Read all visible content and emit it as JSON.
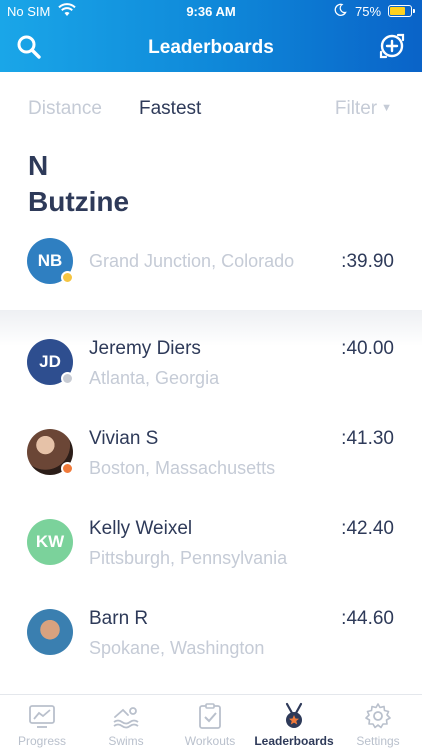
{
  "status_bar": {
    "carrier": "No SIM",
    "time": "9:36 AM",
    "battery": "75%"
  },
  "header": {
    "title": "Leaderboards",
    "search_icon": "search-icon",
    "add_icon": "add-friend-icon"
  },
  "filters": {
    "distance": "Distance",
    "fastest": "Fastest",
    "filter": "Filter",
    "active": "Fastest"
  },
  "athlete": {
    "first_name": "N",
    "last_name": "Butzine"
  },
  "my_entry": {
    "initials": "NB",
    "location": "Grand Junction, Colorado",
    "time": ":39.90",
    "avatar_color": "#2f7fc1",
    "badge_color": "#f5c542"
  },
  "leaderboard": [
    {
      "initials": "JD",
      "name": "Jeremy Diers",
      "location": "Atlanta, Georgia",
      "time": ":40.00",
      "avatar_type": "initials",
      "avatar_color": "#2e4e8f",
      "badge_color": "#c7cbd3"
    },
    {
      "initials": "",
      "name": "Vivian S",
      "location": "Boston, Massachusetts",
      "time": ":41.30",
      "avatar_type": "photo",
      "avatar_color": "#5a3a2c",
      "badge_color": "#f07a3a"
    },
    {
      "initials": "KW",
      "name": "Kelly Weixel",
      "location": "Pittsburgh, Pennsylvania",
      "time": ":42.40",
      "avatar_type": "initials",
      "avatar_color": "#7bd29b",
      "badge_color": ""
    },
    {
      "initials": "",
      "name": "Barn R",
      "location": "Spokane, Washington",
      "time": ":44.60",
      "avatar_type": "photo",
      "avatar_color": "#3a7fb0",
      "badge_color": ""
    }
  ],
  "tabbar": {
    "items": [
      {
        "label": "Progress",
        "icon": "progress-chart-icon"
      },
      {
        "label": "Swims",
        "icon": "swimmer-icon"
      },
      {
        "label": "Workouts",
        "icon": "clipboard-check-icon"
      },
      {
        "label": "Leaderboards",
        "icon": "medal-icon"
      },
      {
        "label": "Settings",
        "icon": "gear-icon"
      }
    ],
    "active": "Leaderboards"
  },
  "colors": {
    "header_start": "#1aa6e8",
    "header_end": "#0a63c8",
    "text_primary": "#2e3a59",
    "text_muted": "#c5cbd6",
    "tab_active": "#2e3a59"
  }
}
